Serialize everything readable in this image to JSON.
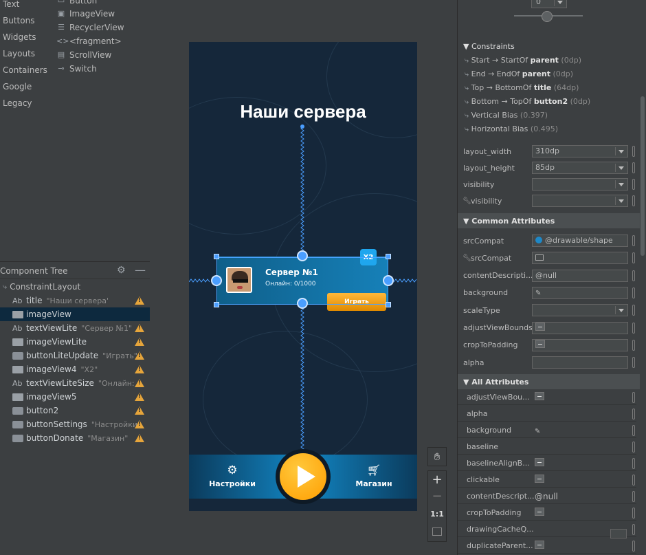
{
  "palette": {
    "categories": [
      "Text",
      "Buttons",
      "Widgets",
      "Layouts",
      "Containers",
      "Google",
      "Legacy"
    ],
    "items": [
      {
        "label": "Button",
        "icon": "button-icon"
      },
      {
        "label": "ImageView",
        "icon": "image-icon"
      },
      {
        "label": "RecyclerView",
        "icon": "list-icon"
      },
      {
        "label": "<fragment>",
        "icon": "code-icon"
      },
      {
        "label": "ScrollView",
        "icon": "scroll-icon"
      },
      {
        "label": "Switch",
        "icon": "toggle-icon"
      }
    ]
  },
  "tree": {
    "title": "Component Tree",
    "root": "ConstraintLayout",
    "rows": [
      {
        "prefix": "Ab",
        "name": "title",
        "value": "\"Наши сервера\"",
        "warn": true,
        "icon": "text-icon"
      },
      {
        "prefix": "",
        "name": "imageView",
        "value": "",
        "warn": false,
        "icon": "image-icon",
        "selected": true
      },
      {
        "prefix": "Ab",
        "name": "textViewLite",
        "value": "\"Сервер №1\"",
        "warn": true,
        "icon": "text-icon"
      },
      {
        "prefix": "",
        "name": "imageViewLite",
        "value": "",
        "warn": true,
        "icon": "image-icon"
      },
      {
        "prefix": "",
        "name": "buttonLiteUpdate",
        "value": "\"Играть\"",
        "warn": true,
        "icon": "button-icon"
      },
      {
        "prefix": "",
        "name": "imageView4",
        "value": "\"X2\"",
        "warn": true,
        "icon": "image-icon"
      },
      {
        "prefix": "Ab",
        "name": "textViewLiteSize",
        "value": "\"Онлайн: ...",
        "warn": true,
        "icon": "text-icon"
      },
      {
        "prefix": "",
        "name": "imageView5",
        "value": "",
        "warn": true,
        "icon": "image-icon"
      },
      {
        "prefix": "",
        "name": "button2",
        "value": "",
        "warn": true,
        "icon": "button-icon"
      },
      {
        "prefix": "",
        "name": "buttonSettings",
        "value": "\"Настройки\"",
        "warn": true,
        "icon": "button-icon"
      },
      {
        "prefix": "",
        "name": "buttonDonate",
        "value": "\"Магазин\"",
        "warn": true,
        "icon": "button-icon"
      }
    ]
  },
  "phone": {
    "title": "Наши сервера",
    "server_name": "Сервер №1",
    "online": "Онлайн: 0/1000",
    "badge": "X2",
    "play_label": "Играть",
    "settings_label": "Настройки",
    "shop_label": "Магазин"
  },
  "zoom": {
    "one_to_one": "1:1"
  },
  "attrs": {
    "spinner_value": "0",
    "constraints_title": "Constraints",
    "constraints": [
      {
        "pre": "Start → StartOf ",
        "bold": "parent",
        "post": " (0dp)"
      },
      {
        "pre": "End → EndOf ",
        "bold": "parent",
        "post": " (0dp)"
      },
      {
        "pre": "Top → BottomOf ",
        "bold": "title",
        "post": " (64dp)"
      },
      {
        "pre": "Bottom → TopOf ",
        "bold": "button2",
        "post": " (0dp)"
      },
      {
        "pre": "Vertical Bias ",
        "bold": "",
        "post": "(0.397)"
      },
      {
        "pre": "Horizontal Bias ",
        "bold": "",
        "post": "(0.495)"
      }
    ],
    "layout_width": {
      "name": "layout_width",
      "value": "310dp"
    },
    "layout_height": {
      "name": "layout_height",
      "value": "85dp"
    },
    "visibility": {
      "name": "visibility",
      "value": ""
    },
    "tools_visibility": {
      "name": "visibility",
      "value": ""
    },
    "common_title": "Common Attributes",
    "common": [
      {
        "name": "srcCompat",
        "value": "@drawable/shape"
      },
      {
        "name": "srcCompat",
        "value": ""
      },
      {
        "name": "contentDescripti...",
        "value": "@null"
      },
      {
        "name": "background",
        "value": ""
      },
      {
        "name": "scaleType",
        "value": ""
      },
      {
        "name": "adjustViewBounds",
        "value": ""
      },
      {
        "name": "cropToPadding",
        "value": ""
      },
      {
        "name": "alpha",
        "value": ""
      }
    ],
    "all_title": "All Attributes",
    "all": [
      {
        "name": "adjustViewBou...",
        "value": ""
      },
      {
        "name": "alpha",
        "value": ""
      },
      {
        "name": "background",
        "value": ""
      },
      {
        "name": "baseline",
        "value": ""
      },
      {
        "name": "baselineAlignB...",
        "value": ""
      },
      {
        "name": "clickable",
        "value": ""
      },
      {
        "name": "contentDescript...",
        "value": "@null"
      },
      {
        "name": "cropToPadding",
        "value": ""
      },
      {
        "name": "drawingCacheQ...",
        "value": ""
      },
      {
        "name": "duplicateParent...",
        "value": ""
      }
    ]
  },
  "colors": {
    "accent": "#ffb300",
    "selection": "#0d293e",
    "badge": "#1fa6ee",
    "phone_bg": "#15273a"
  }
}
